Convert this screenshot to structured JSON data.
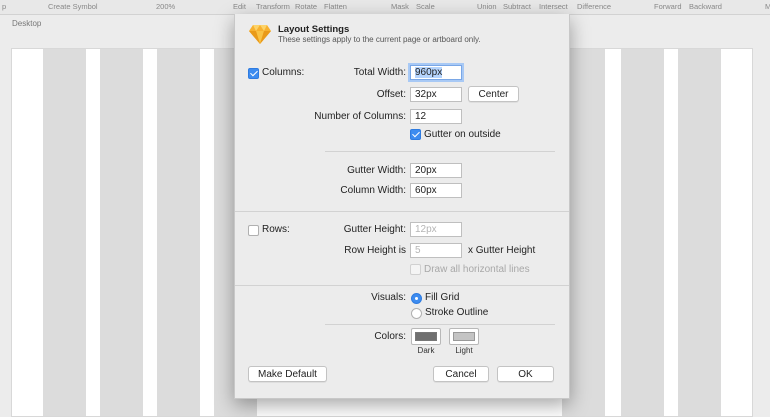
{
  "toolbar": {
    "items": [
      "p",
      "Create Symbol",
      "200%",
      "Edit",
      "Transform",
      "Rotate",
      "Flatten",
      "Mask",
      "Scale",
      "Union",
      "Subtract",
      "Intersect",
      "Difference",
      "Forward",
      "Backward",
      "M"
    ]
  },
  "canvas": {
    "desktop_label": "Desktop"
  },
  "dialog": {
    "title": "Layout Settings",
    "subtitle": "These settings apply to the current page or artboard only.",
    "columns": {
      "checkbox_label": "Columns:",
      "checked": true,
      "total_width_label": "Total Width:",
      "total_width_value": "960px",
      "offset_label": "Offset:",
      "offset_value": "32px",
      "center_button": "Center",
      "num_columns_label": "Number of Columns:",
      "num_columns_value": "12",
      "gutter_outside_label": "Gutter on outside",
      "gutter_outside_checked": true,
      "gutter_width_label": "Gutter Width:",
      "gutter_width_value": "20px",
      "column_width_label": "Column Width:",
      "column_width_value": "60px"
    },
    "rows": {
      "checkbox_label": "Rows:",
      "checked": false,
      "gutter_height_label": "Gutter Height:",
      "gutter_height_value": "12px",
      "row_height_label": "Row Height is",
      "row_height_value": "5",
      "row_height_suffix": "x Gutter Height",
      "draw_lines_label": "Draw all horizontal lines"
    },
    "visuals": {
      "label": "Visuals:",
      "options": [
        "Fill Grid",
        "Stroke Outline"
      ],
      "selected": "Fill Grid"
    },
    "colors": {
      "label": "Colors:",
      "dark_label": "Dark",
      "light_label": "Light",
      "dark_color": "#6f6f6f",
      "light_color": "#c4c4c4"
    },
    "buttons": {
      "make_default": "Make Default",
      "cancel": "Cancel",
      "ok": "OK"
    }
  }
}
